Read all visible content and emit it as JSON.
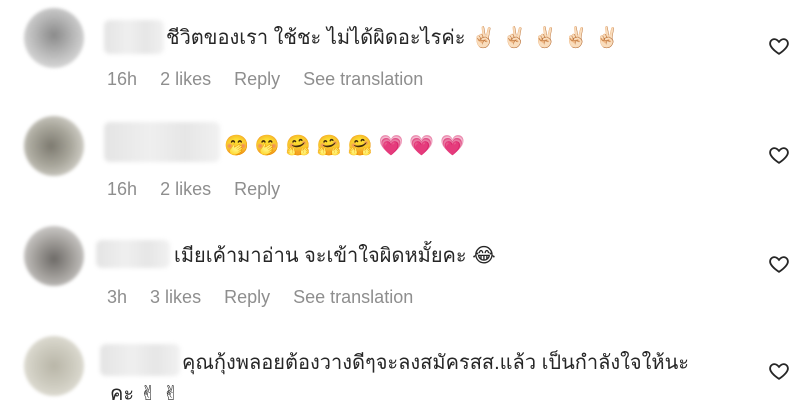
{
  "comments": [
    {
      "text": "ชีวิตของเรา ใช้ชะ ไม่ได้ผิดอะไรค่ะ",
      "emoji": "✌🏻✌🏻✌🏻✌🏻✌🏻",
      "time": "16h",
      "likes": "2 likes",
      "reply": "Reply",
      "translate": "See translation"
    },
    {
      "text": "",
      "emoji": "🤭🤭🤗🤗🤗💗💗💗",
      "time": "16h",
      "likes": "2 likes",
      "reply": "Reply",
      "translate": ""
    },
    {
      "text": "เมียเค้ามาอ่าน จะเข้าใจผิดหมั้ยคะ",
      "emoji": "😂",
      "time": "3h",
      "likes": "3 likes",
      "reply": "Reply",
      "translate": "See translation"
    },
    {
      "text": "คุณกุ้งพลอยต้องวางดีๆจะลงสมัครสส.แล้ว เป็นกำลังใจให้นะ",
      "text2": "คะ",
      "emoji": "✌✌",
      "time": "",
      "likes": "",
      "reply": "",
      "translate": ""
    }
  ],
  "icons": {
    "heart": "heart-outline-icon"
  },
  "colors": {
    "text": "#262626",
    "meta": "#8e8e8e"
  }
}
